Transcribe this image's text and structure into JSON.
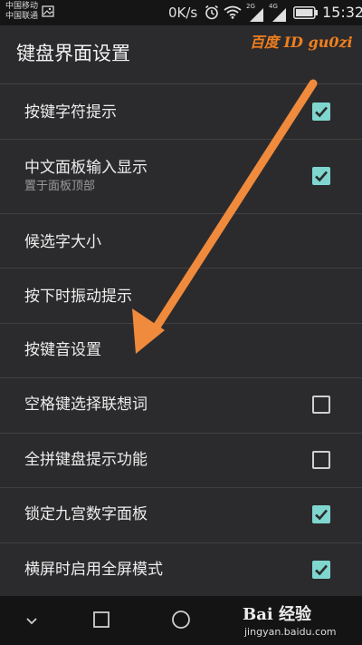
{
  "status_bar": {
    "carrier_1": "中国移动",
    "carrier_2": "中国联通",
    "net_speed": "0K/s",
    "sim1_network": "2G",
    "sim2_network": "4G",
    "time": "15:32",
    "icons": [
      "gallery-icon",
      "alarm-icon",
      "wifi-icon",
      "signal-icon",
      "battery-icon"
    ]
  },
  "app_bar": {
    "title": "键盘界面设置"
  },
  "watermark": {
    "top_text": "百度 ID gu0zi",
    "logo_text": "Bai 经验",
    "site": "jingyan.baidu.com"
  },
  "settings": [
    {
      "title": "按键字符提示",
      "summary": "",
      "checkbox": "checked"
    },
    {
      "title": "中文面板输入显示",
      "summary": "置于面板顶部",
      "checkbox": "checked"
    },
    {
      "title": "候选字大小",
      "summary": "",
      "checkbox": "none"
    },
    {
      "title": "按下时振动提示",
      "summary": "",
      "checkbox": "none"
    },
    {
      "title": "按键音设置",
      "summary": "",
      "checkbox": "none"
    },
    {
      "title": "空格键选择联想词",
      "summary": "",
      "checkbox": "unchecked"
    },
    {
      "title": "全拼键盘提示功能",
      "summary": "",
      "checkbox": "unchecked"
    },
    {
      "title": "锁定九宫数字面板",
      "summary": "",
      "checkbox": "checked"
    },
    {
      "title": "横屏时启用全屏模式",
      "summary": "",
      "checkbox": "checked"
    }
  ],
  "colors": {
    "background": "#2b2b2d",
    "checkbox_checked": "#7fd6cf",
    "annotation_arrow": "#f08a3c",
    "watermark_text": "#f07f1e"
  },
  "nav_bar": {
    "icons": [
      "back-icon",
      "home-icon",
      "recent-apps-icon"
    ]
  }
}
